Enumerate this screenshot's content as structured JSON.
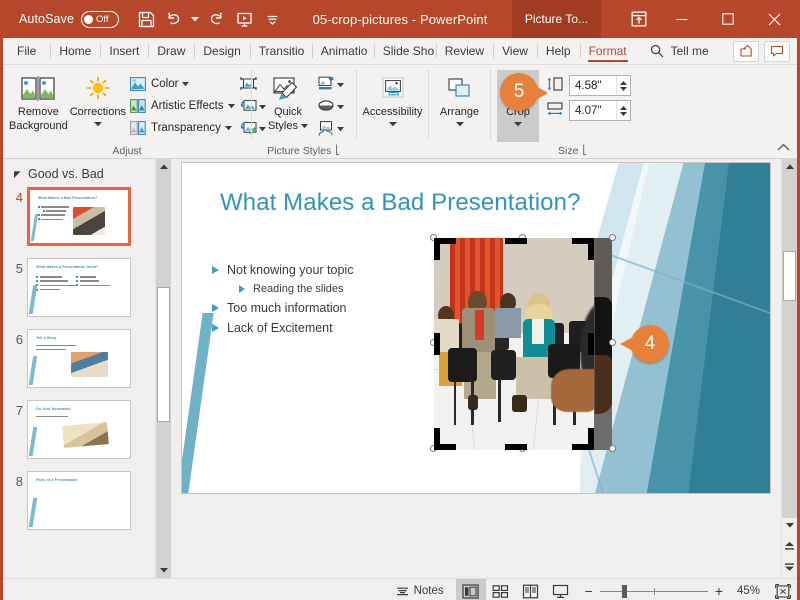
{
  "titlebar": {
    "autosave_label": "AutoSave",
    "autosave_state": "Off",
    "document_title": "05-crop-pictures  -  PowerPoint",
    "context_tab": "Picture To...",
    "qat": [
      {
        "name": "save-icon",
        "label": "Save"
      },
      {
        "name": "undo-icon",
        "label": "Undo"
      },
      {
        "name": "redo-icon",
        "label": "Redo"
      },
      {
        "name": "start-presentation-icon",
        "label": "Start From Beginning"
      },
      {
        "name": "customize-quick-access-toolbar-icon",
        "label": "Customize Quick Access Toolbar"
      }
    ],
    "window_controls": [
      {
        "name": "ribbon-display-options-icon",
        "label": "Ribbon Display Options"
      },
      {
        "name": "minimize-icon",
        "label": "Minimize"
      },
      {
        "name": "maximize-icon",
        "label": "Maximize"
      },
      {
        "name": "close-icon",
        "label": "Close"
      }
    ]
  },
  "tabs": [
    {
      "label": "File",
      "active": false
    },
    {
      "label": "Home",
      "active": false
    },
    {
      "label": "Insert",
      "active": false
    },
    {
      "label": "Draw",
      "active": false
    },
    {
      "label": "Design",
      "active": false
    },
    {
      "label": "Transitio",
      "active": false
    },
    {
      "label": "Animatio",
      "active": false
    },
    {
      "label": "Slide Sho",
      "active": false
    },
    {
      "label": "Review",
      "active": false
    },
    {
      "label": "View",
      "active": false
    },
    {
      "label": "Help",
      "active": false
    },
    {
      "label": "Format",
      "active": true
    }
  ],
  "tellme": {
    "label": "Tell me",
    "icon": "search-icon"
  },
  "tabstrip_right": [
    {
      "name": "share-icon",
      "label": "Share"
    },
    {
      "name": "comments-icon",
      "label": "Comments"
    }
  ],
  "ribbon": {
    "groups": [
      {
        "name": "adjust",
        "label": "Adjust",
        "big_buttons": [
          {
            "name": "remove-background-button",
            "label_line1": "Remove",
            "label_line2": "Background",
            "icon": "remove-background-icon"
          },
          {
            "name": "corrections-button",
            "label_line1": "Corrections",
            "label_line2": "",
            "icon": "corrections-icon",
            "dropdown": true
          }
        ],
        "small_buttons": [
          {
            "name": "color-button",
            "label": "Color",
            "icon": "color-icon",
            "dropdown": true
          },
          {
            "name": "artistic-effects-button",
            "label": "Artistic Effects",
            "icon": "artistic-effects-icon",
            "dropdown": true
          },
          {
            "name": "transparency-button",
            "label": "Transparency",
            "icon": "transparency-icon",
            "dropdown": true
          }
        ],
        "icon_buttons": [
          {
            "name": "compress-pictures-button",
            "icon": "compress-pictures-icon",
            "dropdown": false
          },
          {
            "name": "change-picture-button",
            "icon": "change-picture-icon",
            "dropdown": true
          },
          {
            "name": "reset-picture-button",
            "icon": "reset-picture-icon",
            "dropdown": true
          }
        ]
      },
      {
        "name": "picture-styles",
        "label": "Picture Styles",
        "has_dialog_launcher": true,
        "big_buttons": [
          {
            "name": "quick-styles-button",
            "label_line1": "Quick",
            "label_line2": "Styles",
            "icon": "quick-styles-icon",
            "dropdown_inline": true
          }
        ],
        "icon_buttons": [
          {
            "name": "picture-border-button",
            "icon": "picture-border-icon",
            "dropdown": true
          },
          {
            "name": "picture-effects-button",
            "icon": "picture-effects-icon",
            "dropdown": true
          },
          {
            "name": "picture-layout-button",
            "icon": "picture-layout-icon",
            "dropdown": true
          }
        ]
      },
      {
        "name": "accessibility",
        "label": "",
        "big_buttons": [
          {
            "name": "accessibility-button",
            "label_line1": "Accessibility",
            "label_line2": "",
            "icon": "accessibility-icon",
            "dropdown": true
          }
        ]
      },
      {
        "name": "arrange",
        "label": "",
        "big_buttons": [
          {
            "name": "arrange-button",
            "label_line1": "Arrange",
            "label_line2": "",
            "icon": "arrange-icon",
            "dropdown": true
          }
        ]
      },
      {
        "name": "size",
        "label": "Size",
        "has_dialog_launcher": true,
        "big_buttons": [
          {
            "name": "crop-button",
            "label_line1": "Crop",
            "label_line2": "",
            "icon": "crop-icon",
            "dropdown": true,
            "selected": true
          }
        ],
        "size_fields": [
          {
            "name": "shape-height-field",
            "icon": "shape-height-icon",
            "value": "4.58\""
          },
          {
            "name": "shape-width-field",
            "icon": "shape-width-icon",
            "value": "4.07\""
          }
        ]
      }
    ],
    "collapse_label": "Collapse the Ribbon"
  },
  "thumbnail_pane": {
    "section_title": "Good vs. Bad",
    "slides": [
      {
        "number": "4",
        "title": "What Makes a Bad Presentation?",
        "current": true,
        "bullets": [
          28,
          20,
          24,
          22
        ],
        "has_photo": true,
        "photo": "audience"
      },
      {
        "number": "5",
        "title": "What Makes a Presentation Good?",
        "current": false,
        "bullets": [
          26,
          30,
          38,
          22
        ],
        "bullets2": [
          18,
          20,
          34
        ],
        "has_photo": false
      },
      {
        "number": "6",
        "title": "Tell a Story",
        "current": false,
        "bullets": [
          40,
          30
        ],
        "has_photo": true,
        "photo": "reading"
      },
      {
        "number": "7",
        "title": "Do Your Homework",
        "current": false,
        "bullets": [
          32
        ],
        "has_photo": true,
        "photo": "books"
      },
      {
        "number": "8",
        "title": "Parts of a Presentation",
        "current": false,
        "bullets": [],
        "has_photo": false
      }
    ]
  },
  "slide": {
    "title": "What Makes a Bad Presentation?",
    "bullets": [
      {
        "text": "Not knowing your topic",
        "level": 1
      },
      {
        "text": "Reading the slides",
        "level": 2
      },
      {
        "text": "Too much information",
        "level": 1
      },
      {
        "text": "Lack of Excitement",
        "level": 1
      }
    ],
    "picture": {
      "name": "cropped-picture",
      "alt": "Bored audience sitting in chairs"
    }
  },
  "callouts": [
    {
      "name": "callout-badge-4",
      "number": "4",
      "target": "right-crop-handle"
    },
    {
      "name": "callout-badge-5",
      "number": "5",
      "target": "crop-button"
    }
  ],
  "statusbar": {
    "notes_label": "Notes",
    "views": [
      {
        "name": "normal-view-button",
        "label": "Normal",
        "active": true
      },
      {
        "name": "slide-sorter-button",
        "label": "Slide Sorter",
        "active": false
      },
      {
        "name": "reading-view-button",
        "label": "Reading View",
        "active": false
      },
      {
        "name": "slide-show-button",
        "label": "Slide Show",
        "active": false
      }
    ],
    "zoom_out_label": "−",
    "zoom_in_label": "+",
    "zoom_percent": "45%",
    "fit_label": "Fit slide to current window"
  },
  "colors": {
    "brand": "#b7472a",
    "context_tab": "#a23b21",
    "callout": "#e8803a",
    "slide_title": "#2f93bf",
    "selection": "#e8663e"
  }
}
